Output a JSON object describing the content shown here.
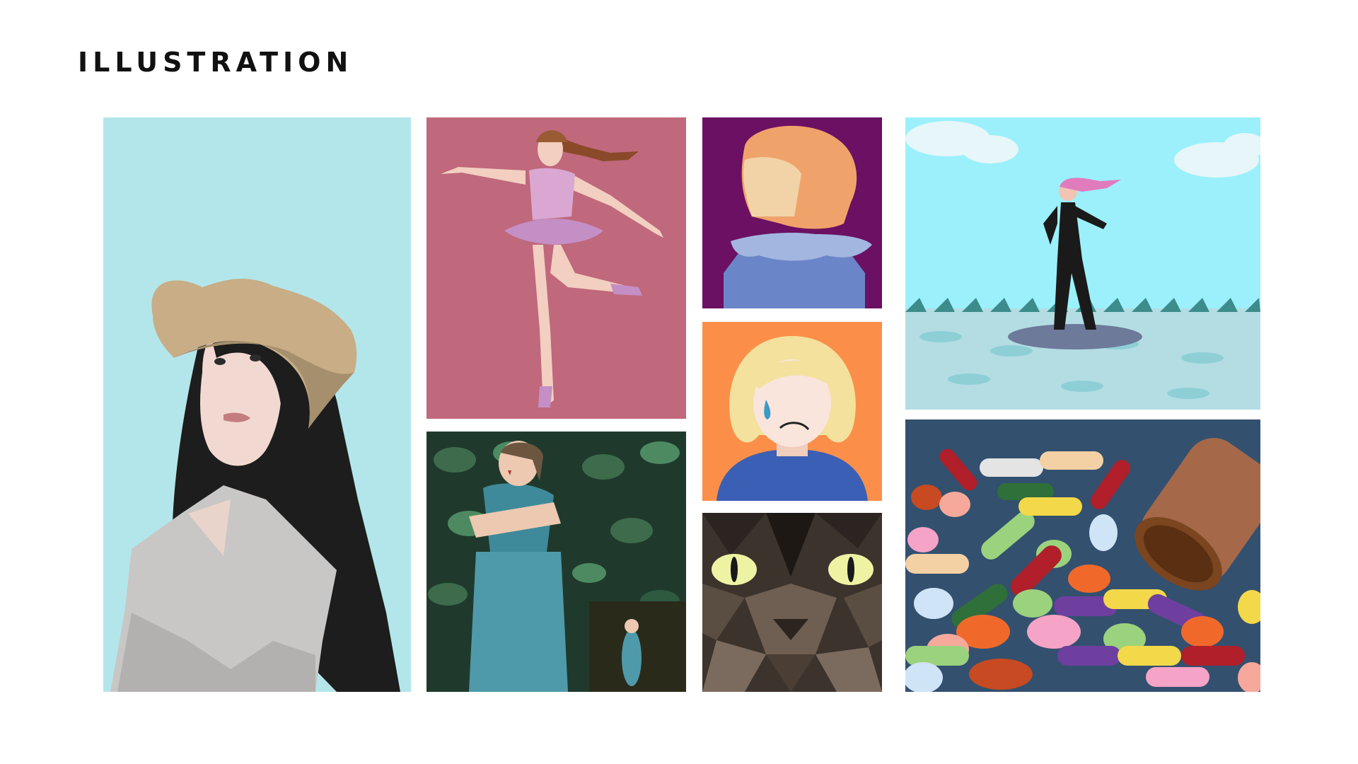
{
  "page": {
    "title": "ILLUSTRATION"
  },
  "gallery": {
    "items": [
      {
        "icon": "woman-with-hat-portrait",
        "bg": "#b3e6ea"
      },
      {
        "icon": "ballerina",
        "bg": "#c0687c"
      },
      {
        "icon": "woman-hugging-herself-in-leaves",
        "bg": "#1f3a2c"
      },
      {
        "icon": "red-haired-woman-from-behind",
        "bg": "#6b1063"
      },
      {
        "icon": "crying-blonde-girl",
        "bg": "#fb8f4a"
      },
      {
        "icon": "low-poly-cat-eyes",
        "bg": "#3c332c"
      },
      {
        "icon": "surfer-on-waves",
        "bg": "#9bf0fb"
      },
      {
        "icon": "spilled-pills-from-bottle",
        "bg": "#33506f"
      }
    ]
  }
}
